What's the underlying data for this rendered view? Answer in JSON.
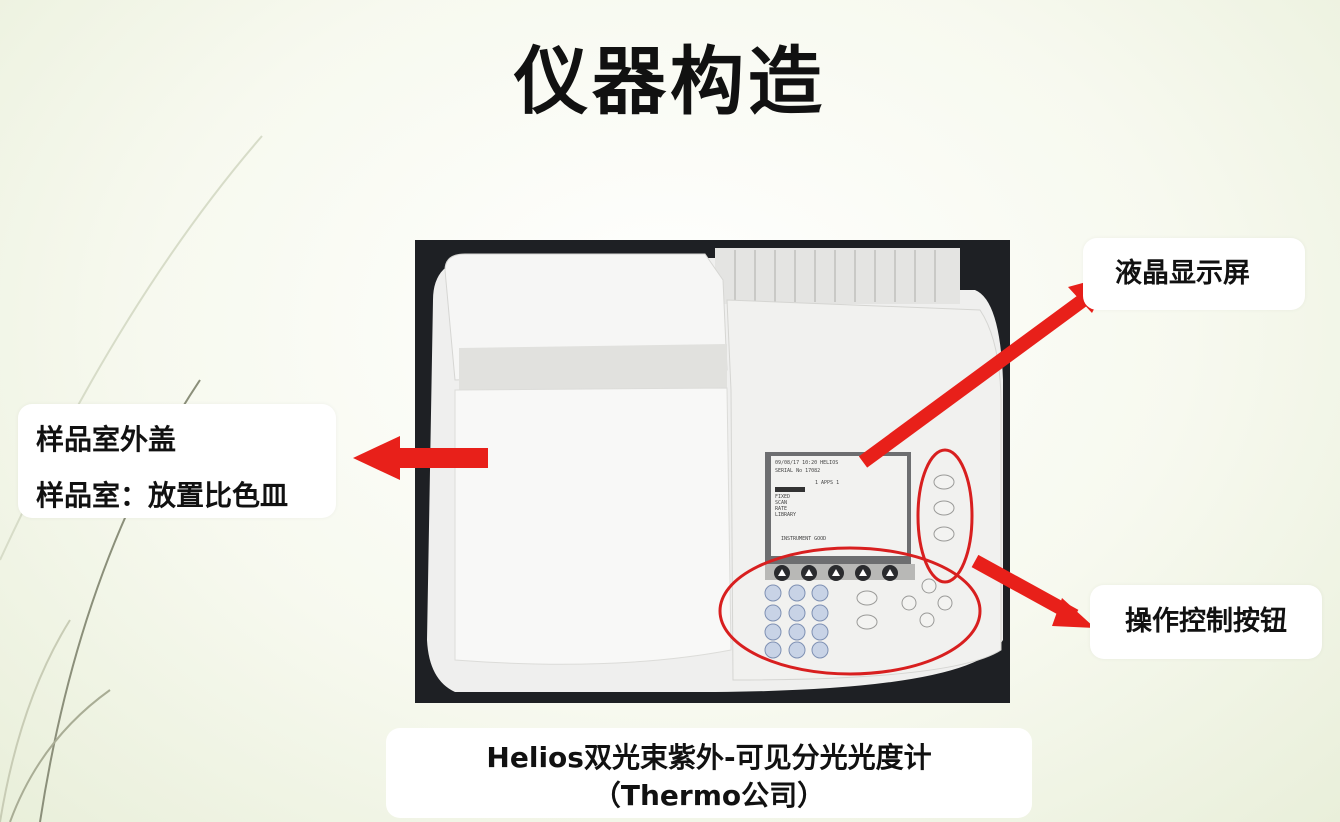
{
  "slide": {
    "title": "仪器构造"
  },
  "labels": {
    "sample_cover": "样品室外盖",
    "sample_chamber": "样品室：放置比色皿",
    "lcd_screen": "液晶显示屏",
    "control_buttons": "操作控制按钮"
  },
  "caption": {
    "line1": "Helios双光束紫外-可见分光光度计",
    "line2": "（Thermo公司）"
  },
  "colors": {
    "arrow": "#e8201a",
    "callout_ring": "#d81f1f",
    "background": "#f4f7ea",
    "photo_bg": "#1e2024"
  },
  "icons": {
    "arrow_left": "arrow-left-icon",
    "arrow_to_screen": "arrow-up-right-icon",
    "arrow_to_buttons": "arrow-down-right-icon"
  }
}
